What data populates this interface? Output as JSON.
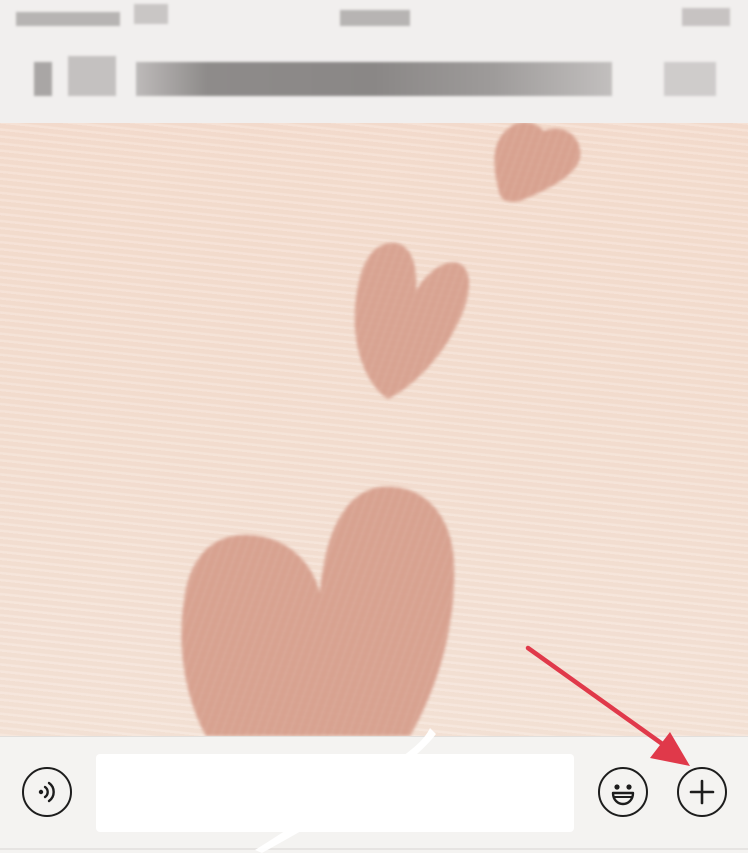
{
  "header": {
    "status_bar": "blurred",
    "title_bar": "blurred"
  },
  "chat": {
    "background": "pink-hearts-wallpaper"
  },
  "input_bar": {
    "voice_icon": "voice-wave-icon",
    "message_placeholder": "",
    "emoji_icon": "smiley-face-icon",
    "plus_icon": "plus-icon"
  },
  "annotation": {
    "arrow_color": "#e0394a",
    "points_to": "plus-button"
  },
  "colors": {
    "header_bg": "#f1efee",
    "wallpaper": "#f4dccd",
    "heart": "#d8a090",
    "input_bar_bg": "#f4f3f1"
  }
}
